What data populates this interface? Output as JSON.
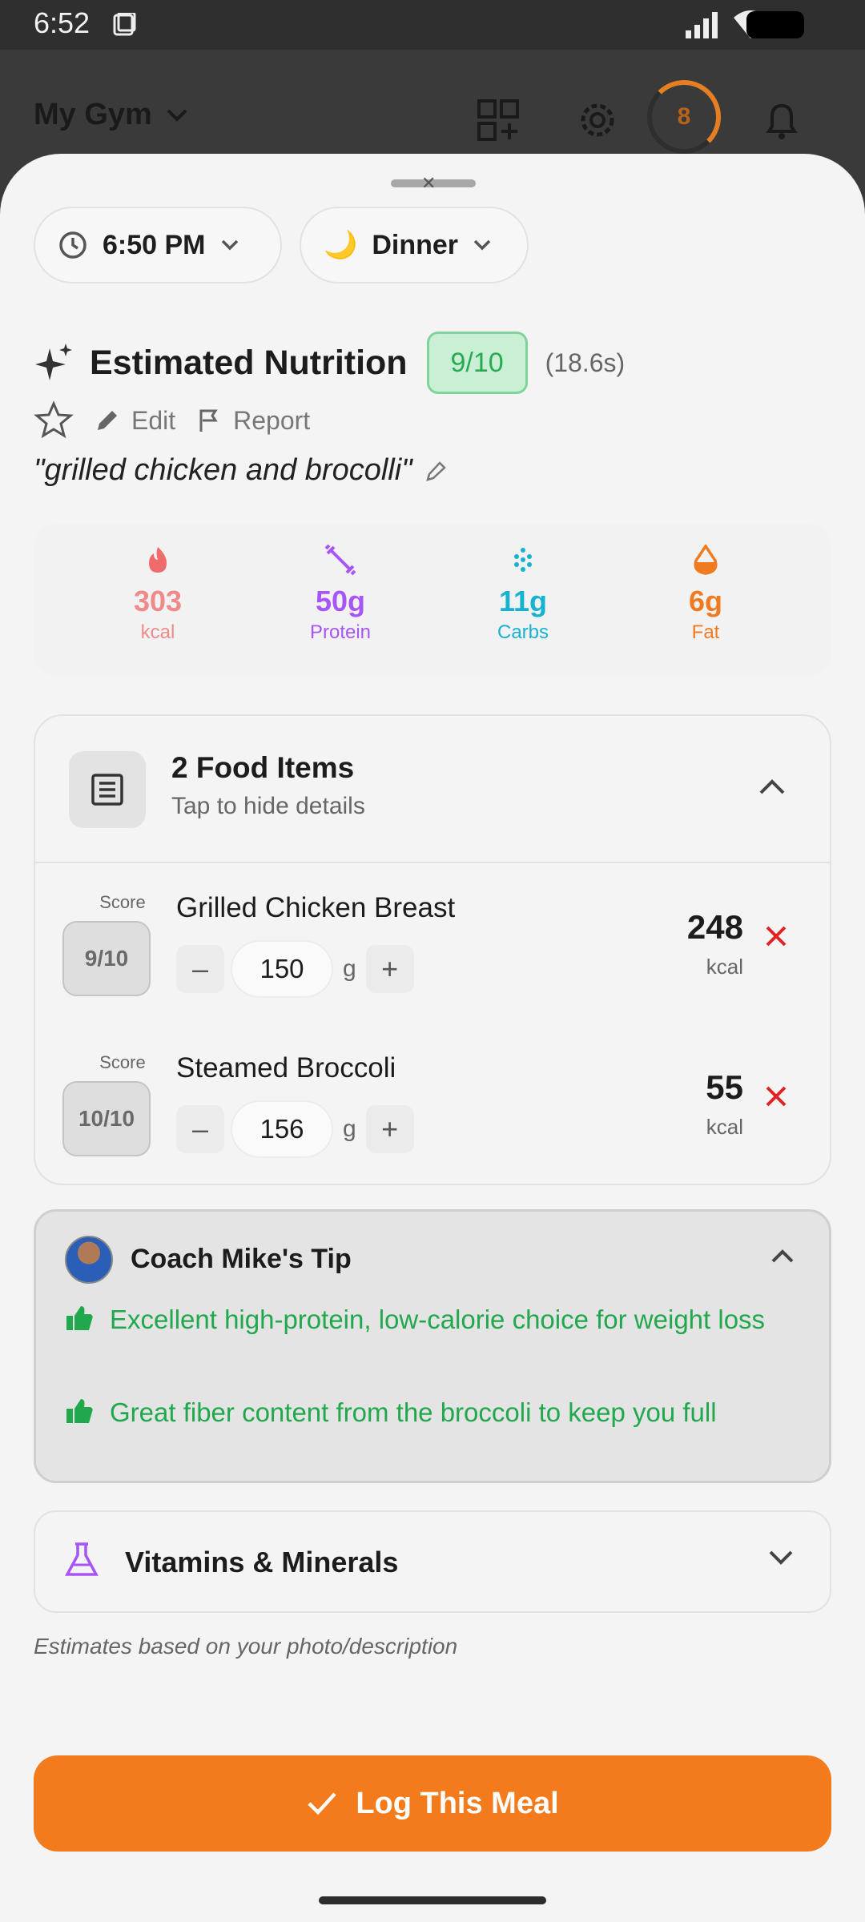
{
  "status_bar": {
    "time": "6:52"
  },
  "app_bar": {
    "title": "My Gym",
    "ring_value": "8"
  },
  "sheet": {
    "time_pill": {
      "label": "6:50 PM"
    },
    "meal_pill": {
      "emoji": "🌙",
      "label": "Dinner"
    },
    "estimate": {
      "title": "Estimated Nutrition",
      "score": "9/10",
      "duration": "(18.6s)"
    },
    "actions": {
      "edit": "Edit",
      "report": "Report"
    },
    "description": "\"grilled chicken and brocolli\"",
    "macros": [
      {
        "value": "303",
        "label": "kcal",
        "color": "#f08a8a"
      },
      {
        "value": "50g",
        "label": "Protein",
        "color": "#a855f7"
      },
      {
        "value": "11g",
        "label": "Carbs",
        "color": "#16b3d0"
      },
      {
        "value": "6g",
        "label": "Fat",
        "color": "#f07a1f"
      }
    ],
    "food": {
      "title": "2 Food Items",
      "subtitle": "Tap to hide details",
      "items": [
        {
          "score_label": "Score",
          "score": "9/10",
          "name": "Grilled Chicken Breast",
          "qty": "150",
          "unit": "g",
          "kcal": "248",
          "kcal_label": "kcal"
        },
        {
          "score_label": "Score",
          "score": "10/10",
          "name": "Steamed Broccoli",
          "qty": "156",
          "unit": "g",
          "kcal": "55",
          "kcal_label": "kcal"
        }
      ]
    },
    "coach": {
      "title": "Coach Mike's Tip",
      "tips": [
        "Excellent high-protein, low-calorie choice for weight loss",
        "Great fiber content from the broccoli to keep you full"
      ]
    },
    "vitamins": {
      "title": "Vitamins & Minerals"
    },
    "note": "Estimates based on your photo/description",
    "log_button": "Log This Meal"
  },
  "colors": {
    "accent": "#f47b1c",
    "success": "#21a84d",
    "danger": "#e02424"
  }
}
